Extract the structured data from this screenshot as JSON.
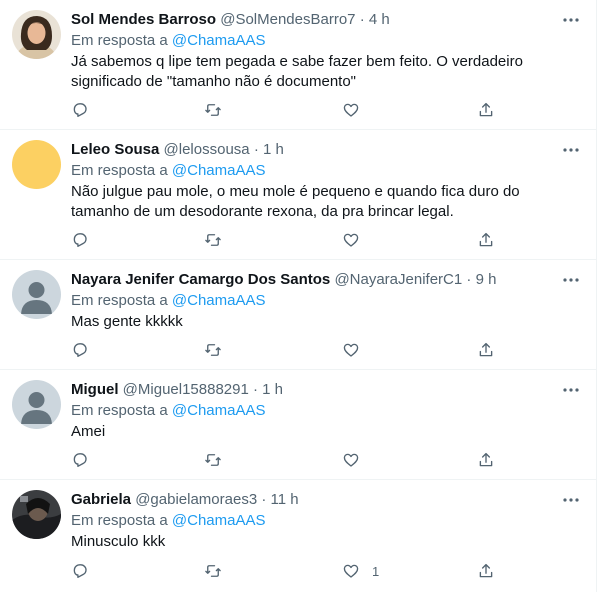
{
  "tweets": [
    {
      "name": "Sol Mendes Barroso",
      "handle": "@SolMendesBarro7",
      "time": "4 h",
      "reply_prefix": "Em resposta a",
      "reply_to": "@ChamaAAS",
      "text": "Já sabemos q lipe tem pegada e sabe fazer bem feito. O verdadeiro significado de \"tamanho não é documento\"",
      "likes": ""
    },
    {
      "name": "Leleo Sousa",
      "handle": "@lelossousa",
      "time": "1 h",
      "reply_prefix": "Em resposta a",
      "reply_to": "@ChamaAAS",
      "text": "Não julgue pau mole, o meu mole é pequeno e quando fica duro do tamanho de um desodorante rexona, da pra brincar legal.",
      "likes": ""
    },
    {
      "name": "Nayara Jenifer Camargo Dos Santos",
      "handle": "@NayaraJeniferC1",
      "time": "9 h",
      "reply_prefix": "Em resposta a",
      "reply_to": "@ChamaAAS",
      "text": "Mas gente kkkkk",
      "likes": ""
    },
    {
      "name": "Miguel",
      "handle": "@Miguel15888291",
      "time": "1 h",
      "reply_prefix": "Em resposta a",
      "reply_to": "@ChamaAAS",
      "text": "Amei",
      "likes": ""
    },
    {
      "name": "Gabriela",
      "handle": "@gabielamoraes3",
      "time": "11 h",
      "reply_prefix": "Em resposta a",
      "reply_to": "@ChamaAAS",
      "text": "Minusculo kkk",
      "likes": "1"
    }
  ],
  "separator": "·",
  "icons": [
    "more-icon",
    "reply-icon",
    "retweet-icon",
    "like-icon",
    "share-icon"
  ],
  "colors": {
    "accent": "#1d9bf0",
    "secondary_text": "#536471",
    "avatar_yellow": "#fcd062",
    "avatar_default": "#ccd6dd"
  }
}
